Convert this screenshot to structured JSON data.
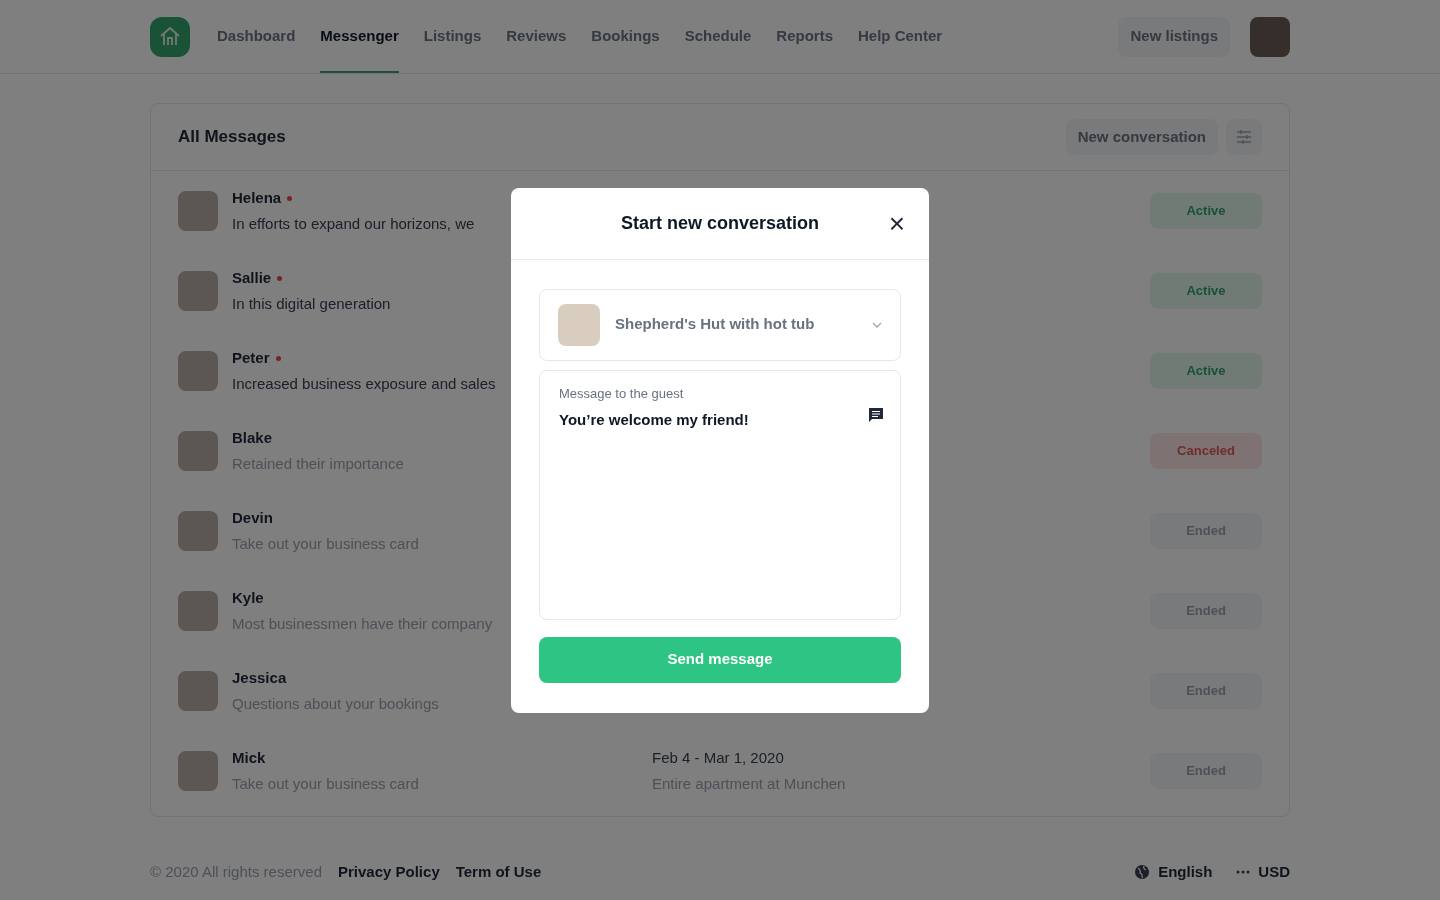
{
  "nav": {
    "tabs": [
      {
        "label": "Dashboard",
        "selected": false
      },
      {
        "label": "Messenger",
        "selected": true
      },
      {
        "label": "Listings",
        "selected": false
      },
      {
        "label": "Reviews",
        "selected": false
      },
      {
        "label": "Bookings",
        "selected": false
      },
      {
        "label": "Schedule",
        "selected": false
      },
      {
        "label": "Reports",
        "selected": false
      },
      {
        "label": "Help Center",
        "selected": false
      }
    ],
    "new_listings": "New listings"
  },
  "messages": {
    "title": "All Messages",
    "new_conversation": "New conversation",
    "rows": [
      {
        "name": "Helena",
        "unread": true,
        "preview": "In efforts to expand our horizons, we",
        "status": {
          "kind": "active",
          "label": "Active"
        }
      },
      {
        "name": "Sallie",
        "unread": true,
        "preview": "In this digital generation",
        "status": {
          "kind": "active",
          "label": "Active"
        }
      },
      {
        "name": "Peter",
        "unread": true,
        "preview": "Increased business exposure and sales",
        "status": {
          "kind": "active",
          "label": "Active"
        }
      },
      {
        "name": "Blake",
        "unread": false,
        "preview": "Retained their importance",
        "status": {
          "kind": "canceled",
          "label": "Canceled"
        }
      },
      {
        "name": "Devin",
        "unread": false,
        "preview": "Take out your business card",
        "status": {
          "kind": "ended",
          "label": "Ended"
        }
      },
      {
        "name": "Kyle",
        "unread": false,
        "preview": "Most businessmen have their company",
        "status": {
          "kind": "ended",
          "label": "Ended"
        }
      },
      {
        "name": "Jessica",
        "unread": false,
        "preview": "Questions about your bookings",
        "status": {
          "kind": "ended",
          "label": "Ended"
        }
      },
      {
        "name": "Mick",
        "unread": false,
        "preview": "Take out your business card",
        "dates": "Feb 4 - Mar 1, 2020",
        "listing": "Entire apartment at Munchen",
        "status": {
          "kind": "ended",
          "label": "Ended"
        }
      }
    ]
  },
  "modal": {
    "title": "Start new conversation",
    "close": "×",
    "listing": "Shepherd's Hut with hot tub",
    "message_label": "Message to the guest",
    "message": "You’re welcome my friend!",
    "send": "Send message"
  },
  "footer": {
    "copyright": "© 2020 All rights reserved",
    "links": [
      "Privacy Policy",
      "Term of Use"
    ],
    "language": "English",
    "currency": "USD"
  }
}
